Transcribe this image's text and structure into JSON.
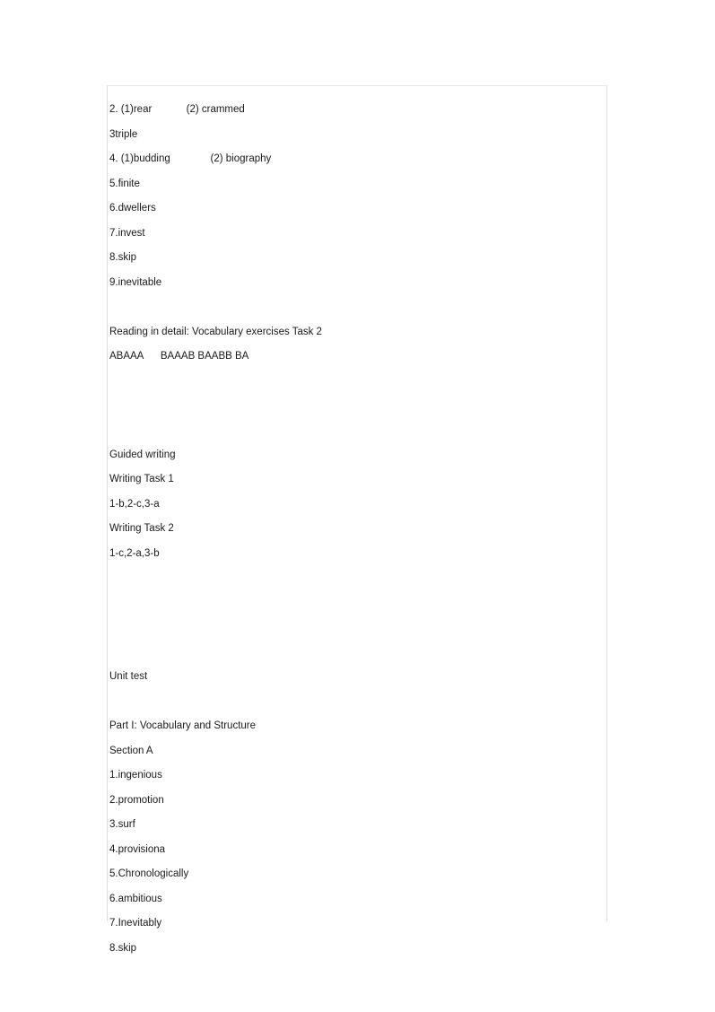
{
  "document": {
    "sections": [
      {
        "name": "answer-key-continued",
        "lines": [
          {
            "text": "2. (1)rear            (2) crammed"
          },
          {
            "text": "3triple"
          },
          {
            "text": "4. (1)budding              (2) biography"
          },
          {
            "text": "5.finite"
          },
          {
            "text": "6.dwellers"
          },
          {
            "text": "7.invest"
          },
          {
            "text": "8.skip"
          },
          {
            "text": "9.inevitable"
          }
        ]
      },
      {
        "name": "reading-in-detail",
        "lines": [
          {
            "text": "Reading in detail: Vocabulary exercises Task 2"
          },
          {
            "text": "ABAAA      BAAAB BAABB BA"
          }
        ]
      },
      {
        "name": "guided-writing",
        "lines": [
          {
            "text": "Guided writing"
          },
          {
            "text": "Writing Task 1"
          },
          {
            "text": "1-b,2-c,3-a"
          },
          {
            "text": "Writing Task 2"
          },
          {
            "text": "1-c,2-a,3-b"
          }
        ]
      },
      {
        "name": "unit-test",
        "lines": [
          {
            "text": "Unit test"
          }
        ]
      },
      {
        "name": "part-one-vocabulary-and-structure",
        "lines": [
          {
            "text": "Part I: Vocabulary and Structure"
          },
          {
            "text": "Section A"
          },
          {
            "text": "1.ingenious"
          },
          {
            "text": "2.promotion"
          },
          {
            "text": "3.surf"
          },
          {
            "text": "4.provisiona"
          },
          {
            "text": "5.Chronologically"
          },
          {
            "text": "6.ambitious"
          },
          {
            "text": "7.Inevitably"
          },
          {
            "text": "8.skip"
          }
        ]
      }
    ]
  }
}
